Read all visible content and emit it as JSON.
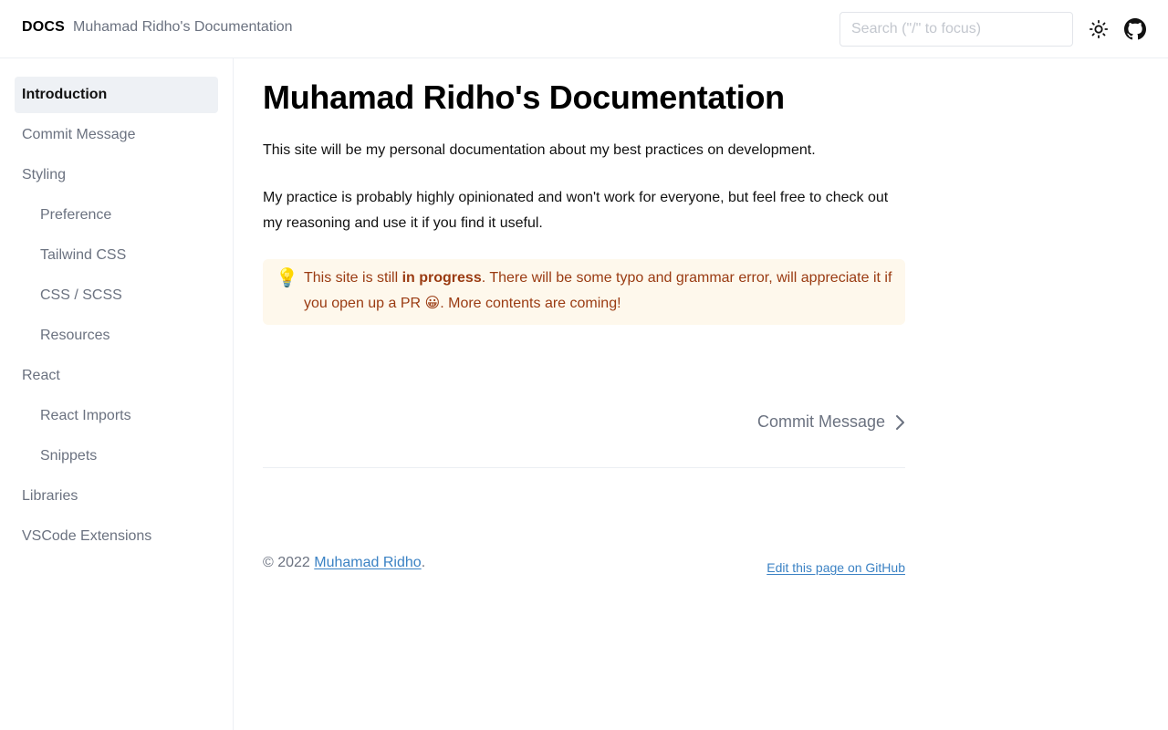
{
  "header": {
    "logo": "DOCS",
    "site_title": "Muhamad Ridho's Documentation",
    "search_placeholder": "Search (\"/\" to focus)",
    "theme_icon": "sun-icon",
    "github_icon": "github-icon"
  },
  "sidebar": {
    "items": [
      {
        "label": "Introduction",
        "active": true,
        "level": 0
      },
      {
        "label": "Commit Message",
        "level": 0
      },
      {
        "label": "Styling",
        "level": 0
      },
      {
        "label": "Preference",
        "level": 1
      },
      {
        "label": "Tailwind CSS",
        "level": 1
      },
      {
        "label": "CSS / SCSS",
        "level": 1
      },
      {
        "label": "Resources",
        "level": 1
      },
      {
        "label": "React",
        "level": 0
      },
      {
        "label": "React Imports",
        "level": 1
      },
      {
        "label": "Snippets",
        "level": 1
      },
      {
        "label": "Libraries",
        "level": 0
      },
      {
        "label": "VSCode Extensions",
        "level": 0
      }
    ]
  },
  "main": {
    "title": "Muhamad Ridho's Documentation",
    "paragraphs": [
      "This site will be my personal documentation about my best practices on development.",
      "My practice is probably highly opinionated and won't work for everyone, but feel free to check out my reasoning and use it if you find it useful."
    ],
    "callout": {
      "icon": "💡",
      "text_before": "This site is still ",
      "text_bold": "in progress",
      "text_after": ". There will be some typo and grammar error, will appreciate it if you open up a PR 😀. More contents are coming!"
    },
    "next_link": "Commit Message"
  },
  "footer": {
    "copyright_prefix": "© 2022 ",
    "author_link": "Muhamad Ridho",
    "copyright_suffix": ".",
    "edit_link": "Edit this page on GitHub"
  },
  "colors": {
    "accent_link": "#3b82c4",
    "callout_bg": "#fef8ec",
    "callout_text": "#9a3b12",
    "active_nav_bg": "#eef1f5"
  }
}
